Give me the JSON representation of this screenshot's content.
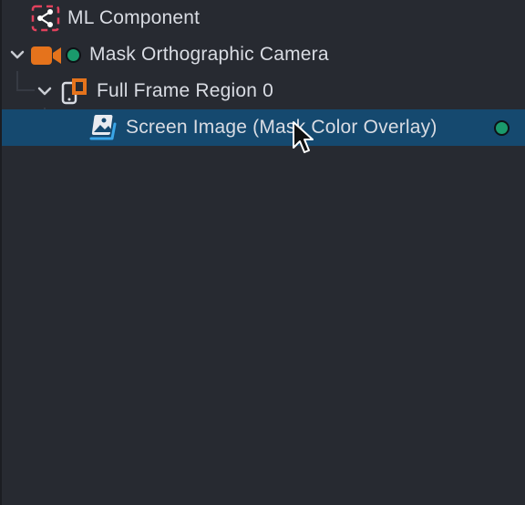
{
  "tree": {
    "items": [
      {
        "label": "ML Component",
        "icon": "ml-component-icon"
      },
      {
        "label": "Mask Orthographic Camera",
        "icon": "camera-icon"
      },
      {
        "label": "Full Frame Region 0",
        "icon": "screen-region-icon"
      },
      {
        "label": "Screen Image (Mask Color Overlay)",
        "icon": "screen-image-icon"
      }
    ]
  },
  "colors": {
    "background": "#272a31",
    "selection": "#15496f",
    "status_green": "#1a9a6c",
    "camera_orange": "#e5731c",
    "ml_pink": "#e0415c",
    "screen_image_blue": "#3aa6e8"
  }
}
